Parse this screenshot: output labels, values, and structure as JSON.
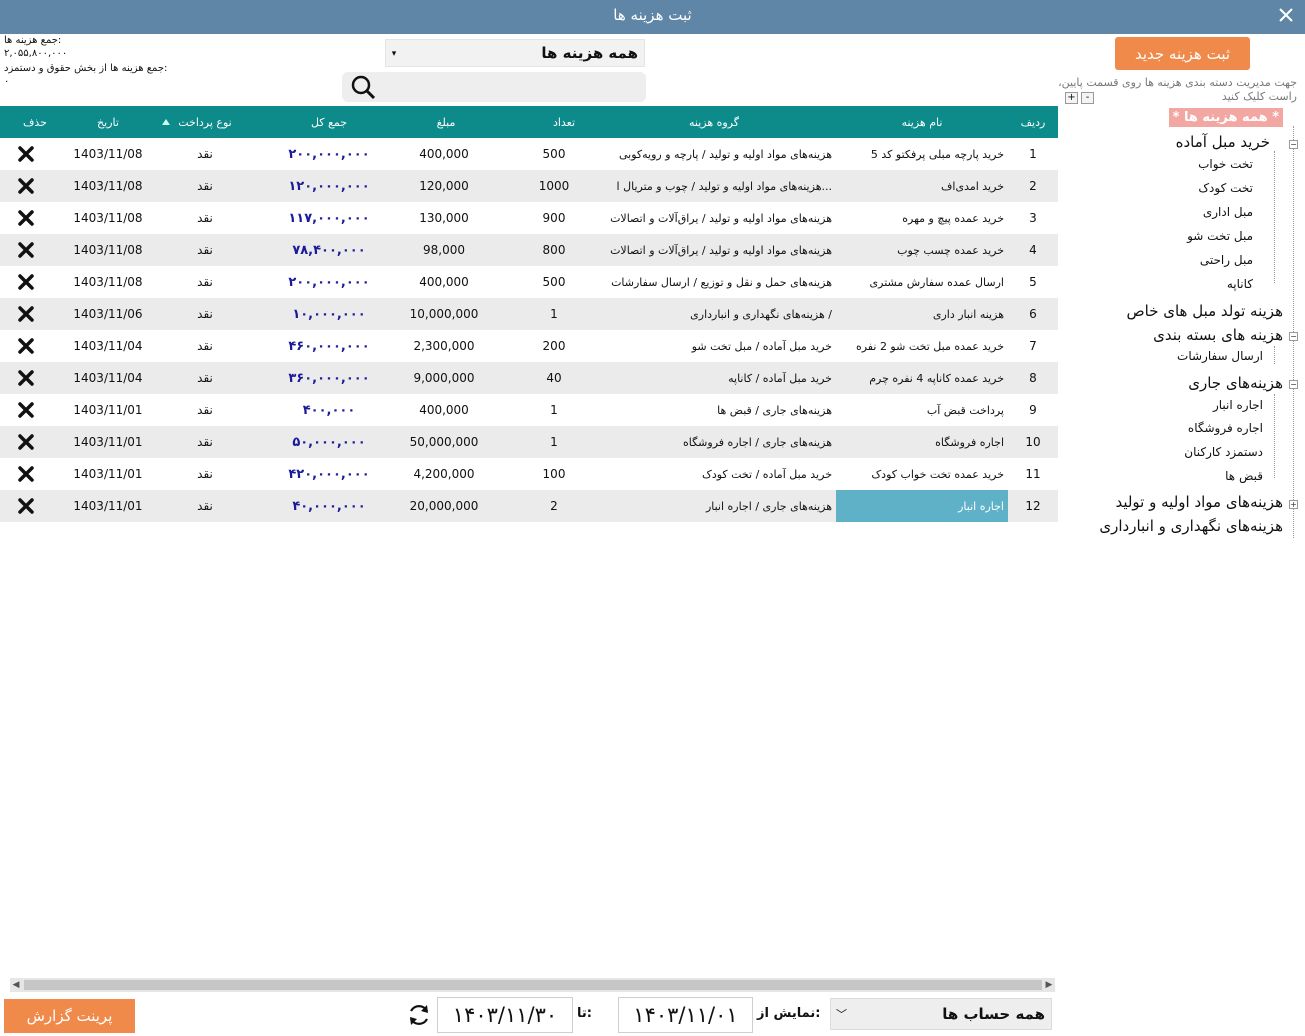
{
  "window": {
    "title": "ثبت هزینه ها"
  },
  "summary": {
    "total_label": "جمع هزینه ها:",
    "total_value": "۲,۰۵۵,۸۰۰,۰۰۰",
    "salary_label": "جمع هزینه ها از بخش حقوق و دستمزد:",
    "salary_value": "۰"
  },
  "filter": {
    "combo_value": "همه هزینه ها",
    "search_value": ""
  },
  "table": {
    "headers": {
      "row": "ردیف",
      "name": "نام هزینه",
      "group": "گروه هزینه",
      "count": "تعداد",
      "amount": "مبلغ",
      "total": "جمع کل",
      "payment": "نوع پرداخت",
      "date": "تاریخ",
      "delete": "حذف"
    },
    "rows": [
      {
        "row": "1",
        "name": "خرید پارچه مبلی پرفکتو کد 5",
        "group": "هزینه‌های مواد اولیه و تولید / پارچه و رویه‌کوبی",
        "count": "500",
        "amount": "400,000",
        "total": "۲۰۰,۰۰۰,۰۰۰",
        "payment": "نقد",
        "date": "1403/11/08"
      },
      {
        "row": "2",
        "name": "خرید امدی‌اف",
        "group": "هزینه‌های مواد اولیه و تولید / چوب و متریال ا...",
        "count": "1000",
        "amount": "120,000",
        "total": "۱۲۰,۰۰۰,۰۰۰",
        "payment": "نقد",
        "date": "1403/11/08"
      },
      {
        "row": "3",
        "name": "خرید عمده پیچ و مهره",
        "group": "هزینه‌های مواد اولیه و تولید / یراق‌آلات و اتصالات",
        "count": "900",
        "amount": "130,000",
        "total": "۱۱۷,۰۰۰,۰۰۰",
        "payment": "نقد",
        "date": "1403/11/08"
      },
      {
        "row": "4",
        "name": "خرید عمده چسب چوب",
        "group": "هزینه‌های مواد اولیه و تولید / یراق‌آلات و اتصالات",
        "count": "800",
        "amount": "98,000",
        "total": "۷۸,۴۰۰,۰۰۰",
        "payment": "نقد",
        "date": "1403/11/08"
      },
      {
        "row": "5",
        "name": "ارسال عمده سفارش مشتری",
        "group": "هزینه‌های حمل و نقل و توزیع / ارسال سفارشات",
        "count": "500",
        "amount": "400,000",
        "total": "۲۰۰,۰۰۰,۰۰۰",
        "payment": "نقد",
        "date": "1403/11/08"
      },
      {
        "row": "6",
        "name": "هزینه انبار داری",
        "group": "هزینه‌های نگهداری و انبارداری /",
        "count": "1",
        "amount": "10,000,000",
        "total": "۱۰,۰۰۰,۰۰۰",
        "payment": "نقد",
        "date": "1403/11/06"
      },
      {
        "row": "7",
        "name": "خرید عمده مبل تخت شو 2 نفره",
        "group": "خرید مبل آماده / مبل تخت شو",
        "count": "200",
        "amount": "2,300,000",
        "total": "۴۶۰,۰۰۰,۰۰۰",
        "payment": "نقد",
        "date": "1403/11/04"
      },
      {
        "row": "8",
        "name": "خرید عمده کاناپه 4 نفره چرم",
        "group": "خرید مبل آماده / کاناپه",
        "count": "40",
        "amount": "9,000,000",
        "total": "۳۶۰,۰۰۰,۰۰۰",
        "payment": "نقد",
        "date": "1403/11/04"
      },
      {
        "row": "9",
        "name": "پرداخت قبض آب",
        "group": "هزینه‌های جاری / قبض ها",
        "count": "1",
        "amount": "400,000",
        "total": "۴۰۰,۰۰۰",
        "payment": "نقد",
        "date": "1403/11/01"
      },
      {
        "row": "10",
        "name": "اجاره فروشگاه",
        "group": "هزینه‌های جاری / اجاره فروشگاه",
        "count": "1",
        "amount": "50,000,000",
        "total": "۵۰,۰۰۰,۰۰۰",
        "payment": "نقد",
        "date": "1403/11/01"
      },
      {
        "row": "11",
        "name": "خرید عمده تخت خواب کودک",
        "group": "خرید مبل آماده / تخت کودک",
        "count": "100",
        "amount": "4,200,000",
        "total": "۴۲۰,۰۰۰,۰۰۰",
        "payment": "نقد",
        "date": "1403/11/01"
      },
      {
        "row": "12",
        "name": "اجاره انبار",
        "group": "هزینه‌های جاری / اجاره انبار",
        "count": "2",
        "amount": "20,000,000",
        "total": "۴۰,۰۰۰,۰۰۰",
        "payment": "نقد",
        "date": "1403/11/01"
      }
    ],
    "selected_row": 12
  },
  "right_panel": {
    "new_button": "ثبت هزینه جدید",
    "hint": "جهت مدیریت دسته بندی هزینه ها روی قسمت پایین، راست کلیک کنید",
    "plus": "+",
    "minus": "-",
    "tree": {
      "all": "* همه هزینه ها *",
      "g1": "خرید مبل آماده",
      "g1_children": [
        "تخت خواب",
        "تخت کودک",
        "مبل اداری",
        "مبل تخت شو",
        "مبل راحتی",
        "کاناپه"
      ],
      "g2": "هزینه تولد مبل های خاص",
      "g3": "هزینه های بسته بندی",
      "g3_children": [
        "ارسال سفارشات"
      ],
      "g4": "هزینه‌های جاری",
      "g4_children": [
        "اجاره انبار",
        "اجاره فروشگاه",
        "دستمزد کارکنان",
        "قبض ها"
      ],
      "g5": "هزینه‌های مواد اولیه و تولید",
      "g6": "هزینه‌های نگهداری و انبارداری"
    }
  },
  "bottom": {
    "print_button": "پرینت گزارش",
    "to_label": "تا:",
    "to_date": "۱۴۰۳/۱۱/۳۰",
    "from_label": "نمایش از:",
    "from_date": "۱۴۰۳/۱۱/۰۱",
    "account_value": "همه حساب ها"
  }
}
